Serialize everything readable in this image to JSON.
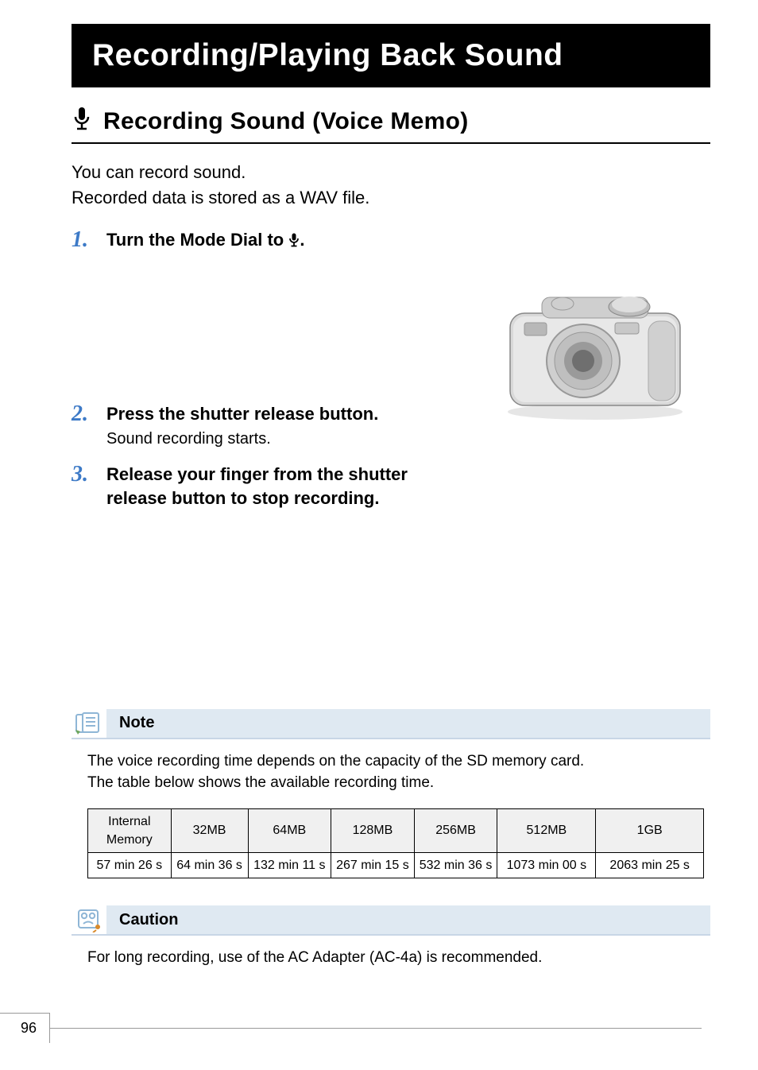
{
  "banner_title": "Recording/Playing Back Sound",
  "section": {
    "icon": "mic-icon",
    "title": "Recording Sound (Voice Memo)"
  },
  "intro_line1": "You can record sound.",
  "intro_line2": "Recorded data is stored as a WAV file.",
  "steps": [
    {
      "num": "1.",
      "title_prefix": "Turn the Mode Dial to ",
      "title_icon": "mic-small-icon",
      "title_suffix": ".",
      "desc": ""
    },
    {
      "num": "2.",
      "title": "Press the shutter release button.",
      "desc": "Sound recording starts."
    },
    {
      "num": "3.",
      "title": "Release your finger from the shutter release button to stop recording.",
      "desc": ""
    }
  ],
  "note": {
    "label": "Note",
    "line1": "The voice recording time depends on the capacity of the SD memory card.",
    "line2": "The table below shows the available recording time."
  },
  "table": {
    "headers": [
      "Internal Memory",
      "32MB",
      "64MB",
      "128MB",
      "256MB",
      "512MB",
      "1GB"
    ],
    "values": [
      "57 min 26 s",
      "64 min 36 s",
      "132 min 11 s",
      "267 min 15 s",
      "532 min 36 s",
      "1073 min 00 s",
      "2063 min 25 s"
    ]
  },
  "caution": {
    "label": "Caution",
    "text": "For long recording, use of the AC Adapter (AC-4a) is recommended."
  },
  "page_number": "96",
  "chart_data": {
    "type": "table",
    "title": "Available voice recording time by storage capacity",
    "categories": [
      "Internal Memory",
      "32MB",
      "64MB",
      "128MB",
      "256MB",
      "512MB",
      "1GB"
    ],
    "values_text": [
      "57 min 26 s",
      "64 min 36 s",
      "132 min 11 s",
      "267 min 15 s",
      "532 min 36 s",
      "1073 min 00 s",
      "2063 min 25 s"
    ]
  }
}
